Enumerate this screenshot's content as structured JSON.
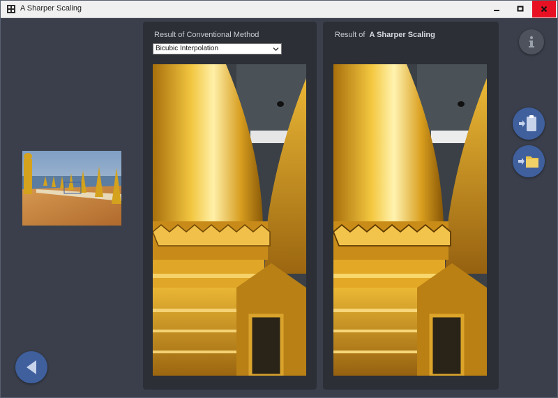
{
  "window": {
    "title": "A Sharper Scaling",
    "title_bar_color": "#f0f0f0",
    "close_color": "#e81123"
  },
  "left_panel": {
    "label": "Result of Conventional Method",
    "select": {
      "value": "Bicubic Interpolation",
      "icon": "chevron-down-icon"
    },
    "image": "zoomed-golden-spire-bicubic"
  },
  "right_panel": {
    "label_prefix": "Result of",
    "label_brand": "A Sharper Scaling",
    "image": "zoomed-golden-spire-sharper"
  },
  "thumbnail": {
    "image": "golden-spires-temple-terrace-by-sea"
  },
  "buttons": {
    "info": {
      "icon": "info-icon"
    },
    "paste": {
      "icon": "paste-clipboard-icon"
    },
    "open": {
      "icon": "open-folder-icon"
    },
    "back": {
      "icon": "back-arrow-icon"
    }
  },
  "colors": {
    "background": "#3a3f4b",
    "panel": "#2c2f36",
    "accent_button": "#3f5f9d",
    "gold": "#d9a520"
  }
}
